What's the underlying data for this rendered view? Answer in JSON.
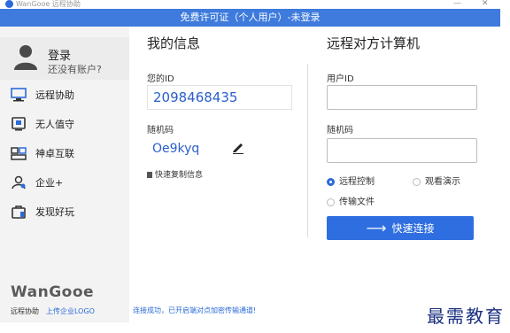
{
  "window": {
    "title": "WanGooe 远程协助",
    "minimize": "—",
    "close": "✕"
  },
  "banner": {
    "text": "免费许可证（个人用户）-未登录"
  },
  "sidebar": {
    "login_title": "登录",
    "login_sub": "还没有账户?",
    "items": [
      {
        "label": "远程协助",
        "icon": "monitor-icon"
      },
      {
        "label": "无人值守",
        "icon": "unattended-icon"
      },
      {
        "label": "神卓互联",
        "icon": "network-icon"
      },
      {
        "label": "企业+",
        "icon": "enterprise-icon"
      },
      {
        "label": "发现好玩",
        "icon": "bag-icon"
      }
    ],
    "brand": "WanGooe",
    "footer_text": "远程协助",
    "footer_link": "上传企业LOGO"
  },
  "my_info": {
    "title": "我的信息",
    "id_label": "您的ID",
    "id_value": "2098468435",
    "code_label": "随机码",
    "code_value": "Oe9kyq",
    "copy_label": "快速复制信息"
  },
  "remote": {
    "title": "远程对方计算机",
    "user_id_label": "用户ID",
    "user_id_value": "",
    "code_label": "随机码",
    "code_value": "",
    "options": [
      {
        "label": "远程控制",
        "selected": true
      },
      {
        "label": "观看演示",
        "selected": false
      },
      {
        "label": "传输文件",
        "selected": false
      }
    ],
    "connect_label": "快速连接",
    "connect_arrow": "⟶"
  },
  "status_text": "连接成功，已开启端对点加密传输通道!",
  "watermark": "最需教育",
  "colors": {
    "banner": "#3e7bdc",
    "accent": "#2f6ee0",
    "id_text": "#2a5fc9",
    "sidebar": "#f3f3f3"
  }
}
